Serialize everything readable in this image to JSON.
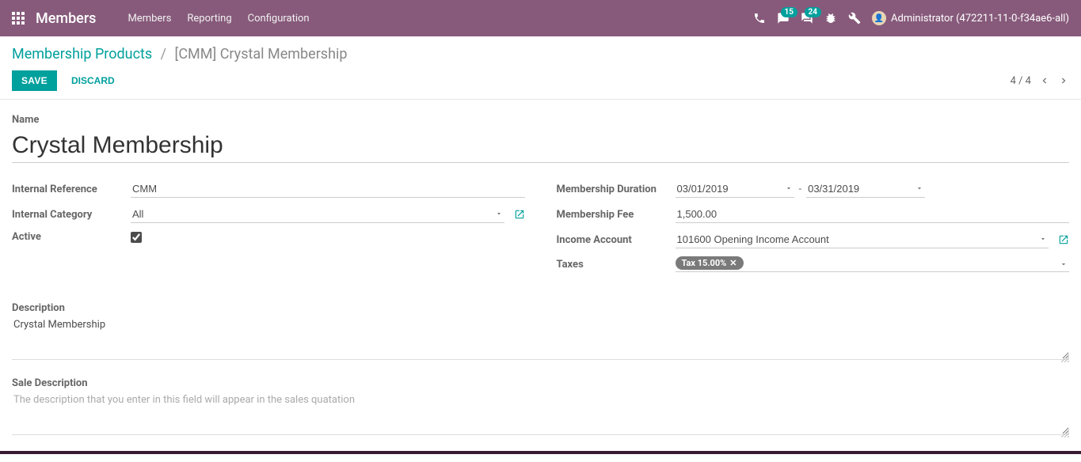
{
  "topbar": {
    "app_title": "Members",
    "nav": [
      "Members",
      "Reporting",
      "Configuration"
    ],
    "badge_msg": "15",
    "badge_chat": "24",
    "user_label": "Administrator (472211-11-0-f34ae6-all)"
  },
  "breadcrumb": {
    "parent": "Membership Products",
    "current": "[CMM] Crystal Membership"
  },
  "actions": {
    "save": "SAVE",
    "discard": "DISCARD",
    "pager_text": "4 / 4"
  },
  "form": {
    "name_label": "Name",
    "name_value": "Crystal Membership",
    "left": {
      "iref_label": "Internal Reference",
      "iref_value": "CMM",
      "icat_label": "Internal Category",
      "icat_value": "All",
      "active_label": "Active"
    },
    "right": {
      "dur_label": "Membership Duration",
      "dur_from": "03/01/2019",
      "dur_to": "03/31/2019",
      "fee_label": "Membership Fee",
      "fee_value": "1,500.00",
      "inc_label": "Income Account",
      "inc_value": "101600 Opening Income Account",
      "tax_label": "Taxes",
      "tax_tag": "Tax 15.00%"
    },
    "desc_label": "Description",
    "desc_value": "Crystal Membership",
    "sale_label": "Sale Description",
    "sale_placeholder": "The description that you enter in this field will appear in the sales quatation"
  }
}
